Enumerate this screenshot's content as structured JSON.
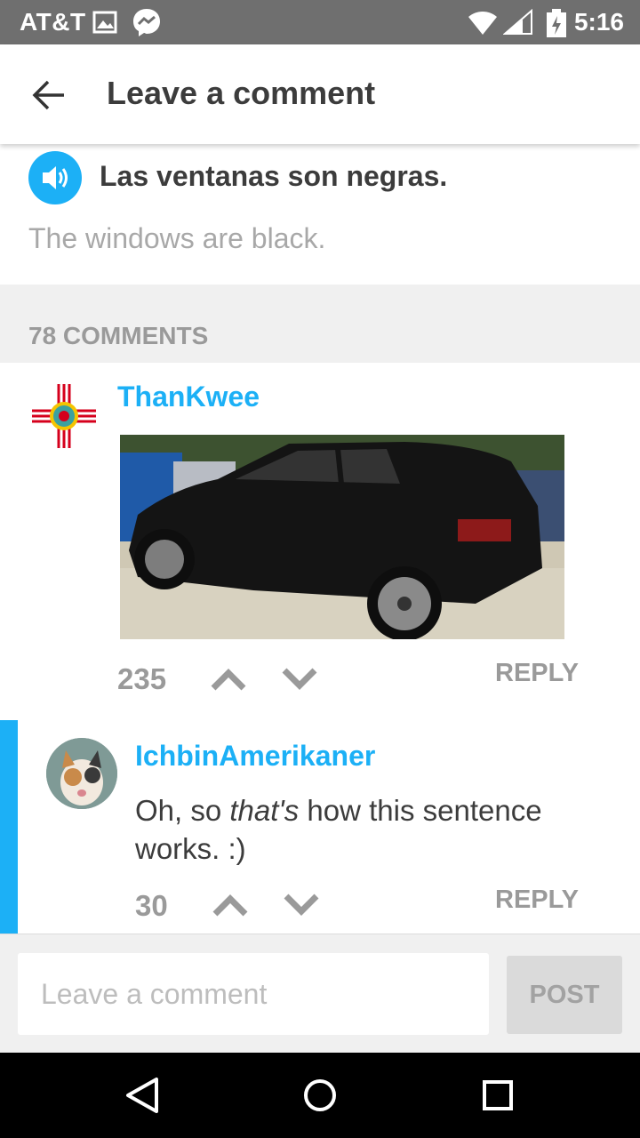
{
  "status_bar": {
    "carrier": "AT&T",
    "time": "5:16"
  },
  "app_bar": {
    "title": "Leave a comment"
  },
  "sentence": {
    "spanish": "Las ventanas son negras.",
    "english": "The windows are black."
  },
  "comments_count_label": "78 COMMENTS",
  "comments": [
    {
      "username": "ThanKwee",
      "votes": "235",
      "reply_label": "REPLY"
    },
    {
      "username": "IchbinAmerikaner",
      "text_before": "Oh, so ",
      "text_emphasis": "that's",
      "text_after": " how this sentence works. :)",
      "votes": "30",
      "reply_label": "REPLY"
    }
  ],
  "composer": {
    "placeholder": "Leave a comment",
    "post_label": "POST"
  },
  "colors": {
    "accent": "#1cb0f6",
    "status_bar": "#6f6f6f",
    "text": "#3c3c3c",
    "muted": "#9a9a9a"
  }
}
